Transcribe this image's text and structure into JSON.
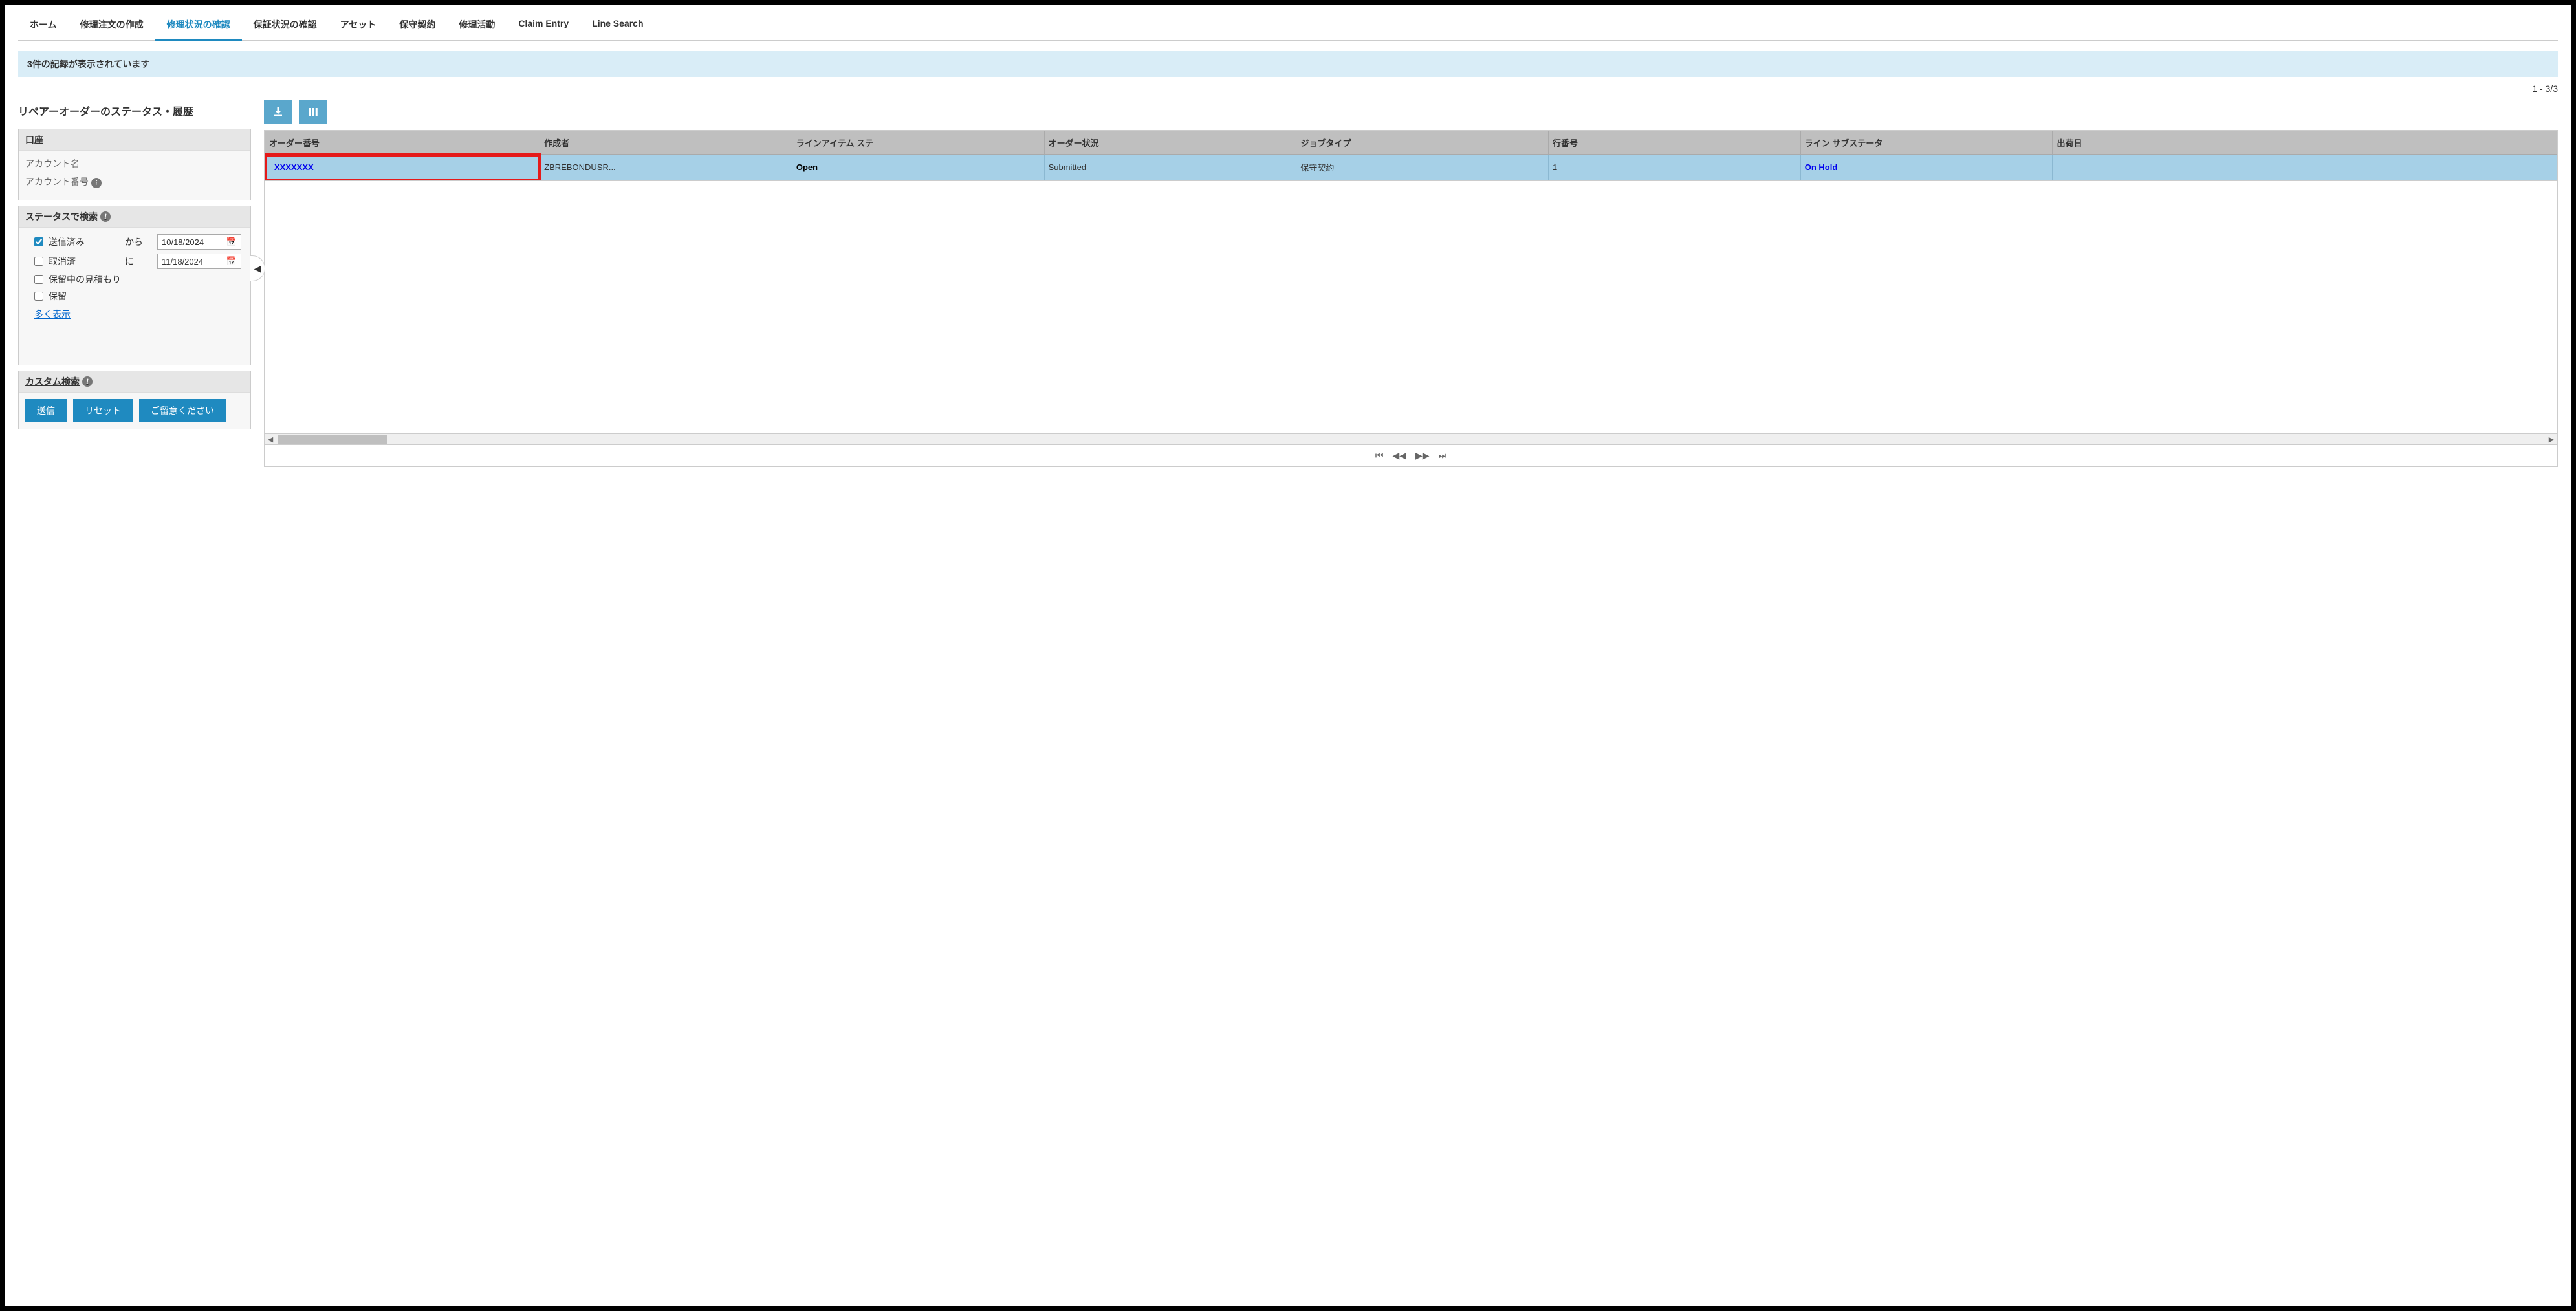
{
  "tabs": {
    "home": "ホーム",
    "create_repair": "修理注文の作成",
    "repair_status": "修理状況の確認",
    "warranty_status": "保証状況の確認",
    "asset": "アセット",
    "contract": "保守契約",
    "repair_activity": "修理活動",
    "claim_entry": "Claim Entry",
    "line_search": "Line Search"
  },
  "info_bar": "3件の記録が表示されています",
  "page_count": "1 - 3/3",
  "sidebar": {
    "title": "リペアーオーダーのステータス・履歴",
    "account": {
      "header": "口座",
      "name_label": "アカウント名",
      "number_label": "アカウント番号"
    },
    "status": {
      "header": "ステータスで検索",
      "sent": "送信済み",
      "from": "から",
      "cancelled": "取消済",
      "to": "に",
      "pending_quote": "保留中の見積もり",
      "on_hold": "保留",
      "date_from": "10/18/2024",
      "date_to": "11/18/2024",
      "show_more": "多く表示"
    },
    "custom": {
      "header": "カスタム検索"
    },
    "buttons": {
      "submit": "送信",
      "reset": "リセット",
      "notice": "ご留意ください"
    }
  },
  "table": {
    "headers": {
      "order_no": "オーダー番号",
      "creator": "作成者",
      "line_item_status": "ラインアイテム ステ",
      "order_status": "オーダー状況",
      "job_type": "ジョブタイプ",
      "line_no": "行番号",
      "line_substatus": "ライン サブステータ",
      "ship_date": "出荷日"
    },
    "row": {
      "order_no": "XXXXXXX",
      "creator": "ZBREBONDUSR...",
      "line_item_status": "Open",
      "order_status": "Submitted",
      "job_type": "保守契約",
      "line_no": "1",
      "line_substatus": "On Hold",
      "ship_date": ""
    }
  }
}
